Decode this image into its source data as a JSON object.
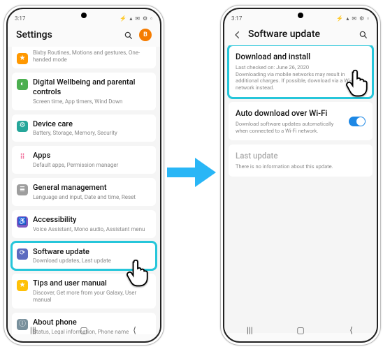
{
  "status": {
    "time": "3:17",
    "icons": "⚡ ▴ ✉ ⚙ ▫"
  },
  "left": {
    "title": "Settings",
    "avatar": "B",
    "items": [
      {
        "title": "",
        "subtitle": "Bixby Routines, Motions and gestures, One-handed mode",
        "color": "c-orange",
        "glyph": "★"
      },
      {
        "title": "Digital Wellbeing and parental controls",
        "subtitle": "Screen time, App timers, Wind Down",
        "color": "c-green",
        "glyph": "◐"
      },
      {
        "title": "Device care",
        "subtitle": "Battery, Storage, Memory, Security",
        "color": "c-teal",
        "glyph": "⚙"
      },
      {
        "title": "Apps",
        "subtitle": "Default apps, Permission manager",
        "color": "c-ltblue",
        "glyph": "⠿"
      },
      {
        "title": "General management",
        "subtitle": "Language and input, Date and time, Reset",
        "color": "c-grey",
        "glyph": "≣"
      },
      {
        "title": "Accessibility",
        "subtitle": "Voice Assistant, Mono audio, Assistant menu",
        "color": "c-purple",
        "glyph": "♿"
      },
      {
        "title": "Software update",
        "subtitle": "Download updates, Last update",
        "color": "c-darkblue",
        "glyph": "⟳"
      },
      {
        "title": "Tips and user manual",
        "subtitle": "Discover, Get more from your Galaxy, User manual",
        "color": "c-yellow",
        "glyph": "★"
      },
      {
        "title": "About phone",
        "subtitle": "Status, Legal information, Phone name",
        "color": "c-greyblue",
        "glyph": "ⓘ"
      }
    ]
  },
  "right": {
    "title": "Software update",
    "items": [
      {
        "title": "Download and install",
        "subtitle": "Last checked on: June 26, 2020\nDownloading via mobile networks may result in additional charges. If possible, download via a Wi-Fi network instead."
      },
      {
        "title": "Auto download over Wi-Fi",
        "subtitle": "Download software updates automatically when connected to a Wi-Fi network."
      },
      {
        "title": "Last update",
        "subtitle": "There is no information about this update."
      }
    ]
  }
}
